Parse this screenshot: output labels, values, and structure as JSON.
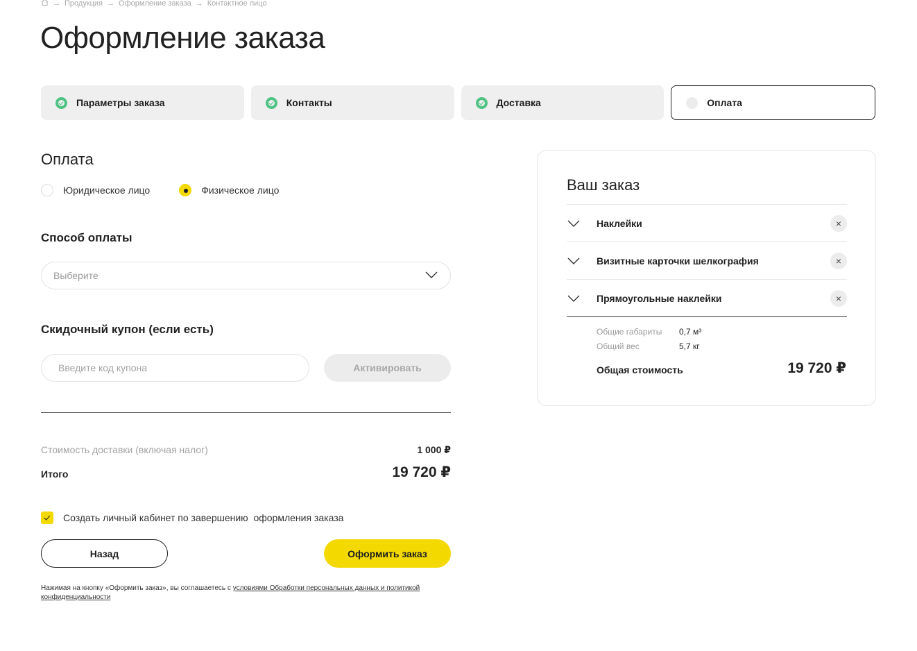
{
  "breadcrumb": {
    "home_icon": "home-icon",
    "items": [
      "Продукция",
      "Оформление заказа",
      "Контактное лицо"
    ],
    "separator": "→"
  },
  "page_title": "Оформление заказа",
  "steps": [
    {
      "label": "Параметры заказа",
      "status": "done"
    },
    {
      "label": "Контакты",
      "status": "done"
    },
    {
      "label": "Доставка",
      "status": "done"
    },
    {
      "label": "Оплата",
      "status": "active"
    }
  ],
  "payment": {
    "title": "Оплата",
    "options": [
      {
        "label": "Юридическое лицо",
        "selected": false
      },
      {
        "label": "Физическое лицо",
        "selected": true
      }
    ],
    "method_title": "Способ оплаты",
    "method_placeholder": "Выберите",
    "coupon_title": "Скидочный купон (если есть)",
    "coupon_placeholder": "Введите код купона",
    "activate_label": "Активировать"
  },
  "totals": {
    "delivery_label": "Стоимость доставки (включая налог)",
    "delivery_value": "1 000 ₽",
    "total_label": "Итого",
    "total_value": "19 720 ₽"
  },
  "create_account": {
    "label": "Создать личный кабинет по завершению  оформления заказа",
    "checked": true
  },
  "buttons": {
    "back": "Назад",
    "submit": "Оформить заказ"
  },
  "legal": {
    "text": "Нажимая на кнопку «Оформить заказ», вы соглашаетесь с ",
    "link": "условиями Обработки персональных данных и политикой конфиденциальности"
  },
  "summary": {
    "title": "Ваш заказ",
    "items": [
      {
        "name": "Наклейки"
      },
      {
        "name": "Визитные карточки шелкография"
      },
      {
        "name": "Прямоугольные наклейки"
      }
    ],
    "dims_label": "Общие габариты",
    "dims_value": "0,7 м³",
    "weight_label": "Общий вес",
    "weight_value": "5,7 кг",
    "total_label": "Общая стоимость",
    "total_value": "19 720 ₽"
  },
  "colors": {
    "accent": "#f3d900",
    "success": "#4fc383",
    "text": "#1d1d1d",
    "muted": "#a8a8a8"
  }
}
